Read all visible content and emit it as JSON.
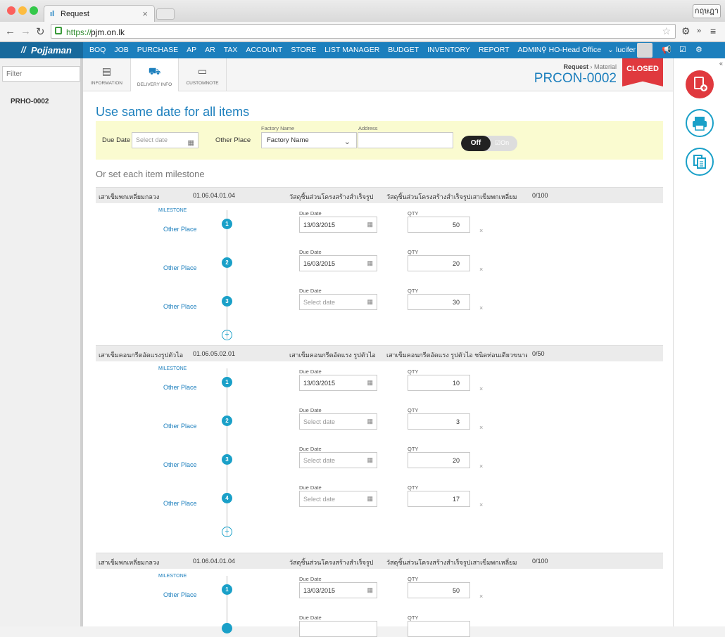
{
  "browser": {
    "tab_title": "Request",
    "url_scheme": "https://",
    "url_host": "pjm.on.lk",
    "lang_button": "กฤษฎา"
  },
  "topnav": {
    "brand": "Pojjaman",
    "menu": [
      "BOQ",
      "JOB",
      "PURCHASE",
      "AP",
      "AR",
      "TAX",
      "ACCOUNT",
      "STORE",
      "LIST MANAGER",
      "BUDGET",
      "INVENTORY",
      "REPORT",
      "ADMIN"
    ],
    "office": "HO-Head Office",
    "user": "lucifer"
  },
  "sidebar": {
    "filter_placeholder": "Filter",
    "items": [
      "PRHO-0002"
    ]
  },
  "subtabs": [
    "INFORMATION",
    "DELIVERY INFO",
    "CUSTOMNOTE"
  ],
  "header": {
    "breadcrumb_parent": "Request",
    "breadcrumb_sep": "›",
    "breadcrumb_current": "Material",
    "doc_no": "PRCON-0002",
    "status": "CLOSED"
  },
  "same_date": {
    "title": "Use same date for all items",
    "due_date_label": "Due Date",
    "due_date_placeholder": "Select date",
    "other_place_label": "Other Place",
    "factory_name_label": "Factory Name",
    "factory_name_value": "Factory Name",
    "address_label": "Address",
    "toggle_off": "Off",
    "toggle_on": "On"
  },
  "milestone_section_title": "Or set each item milestone",
  "labels": {
    "milestone": "MILESTONE",
    "other_place": "Other Place",
    "due_date": "Due Date",
    "qty": "QTY",
    "select_date": "Select date",
    "delete": "×",
    "add": "+"
  },
  "items": [
    {
      "name": "เสาเข็มพกเหลี่ยมกลวง",
      "code": "01.06.04.01.04",
      "category": "วัสดุชิ้นส่วนโครงสร้างสำเร็จรูป",
      "description": "วัสดุชิ้นส่วนโครงสร้างสำเร็จรูปเสาเข็มพกเหลี่ยม",
      "progress": "0/100",
      "milestones": [
        {
          "no": "1",
          "date": "13/03/2015",
          "qty": "50"
        },
        {
          "no": "2",
          "date": "16/03/2015",
          "qty": "20"
        },
        {
          "no": "3",
          "date": "",
          "qty": "30"
        }
      ]
    },
    {
      "name": "เสาเข็มคอนกรีตอัดแรงรูปตัวไอ",
      "code": "01.06.05.02.01",
      "category": "เสาเข็มคอนกรีตอัดแรง รูปตัวไอ",
      "description": "เสาเข็มคอนกรีตอัดแรง รูปตัวไอ ชนิดท่อนเดียวขนาด",
      "progress": "0/50",
      "milestones": [
        {
          "no": "1",
          "date": "13/03/2015",
          "qty": "10"
        },
        {
          "no": "2",
          "date": "",
          "qty": "3"
        },
        {
          "no": "3",
          "date": "",
          "qty": "20"
        },
        {
          "no": "4",
          "date": "",
          "qty": "17"
        }
      ]
    },
    {
      "name": "เสาเข็มพกเหลี่ยมกลวง",
      "code": "01.06.04.01.04",
      "category": "วัสดุชิ้นส่วนโครงสร้างสำเร็จรูป",
      "description": "วัสดุชิ้นส่วนโครงสร้างสำเร็จรูปเสาเข็มพกเหลี่ยม",
      "progress": "0/100",
      "milestones": [
        {
          "no": "1",
          "date": "13/03/2015",
          "qty": "50"
        },
        {
          "no": "",
          "date": "",
          "qty": ""
        }
      ]
    }
  ],
  "colors": {
    "brand_blue": "#1c7fbd",
    "closed_red": "#e0393e",
    "highlight_yellow": "#fafbd0"
  }
}
